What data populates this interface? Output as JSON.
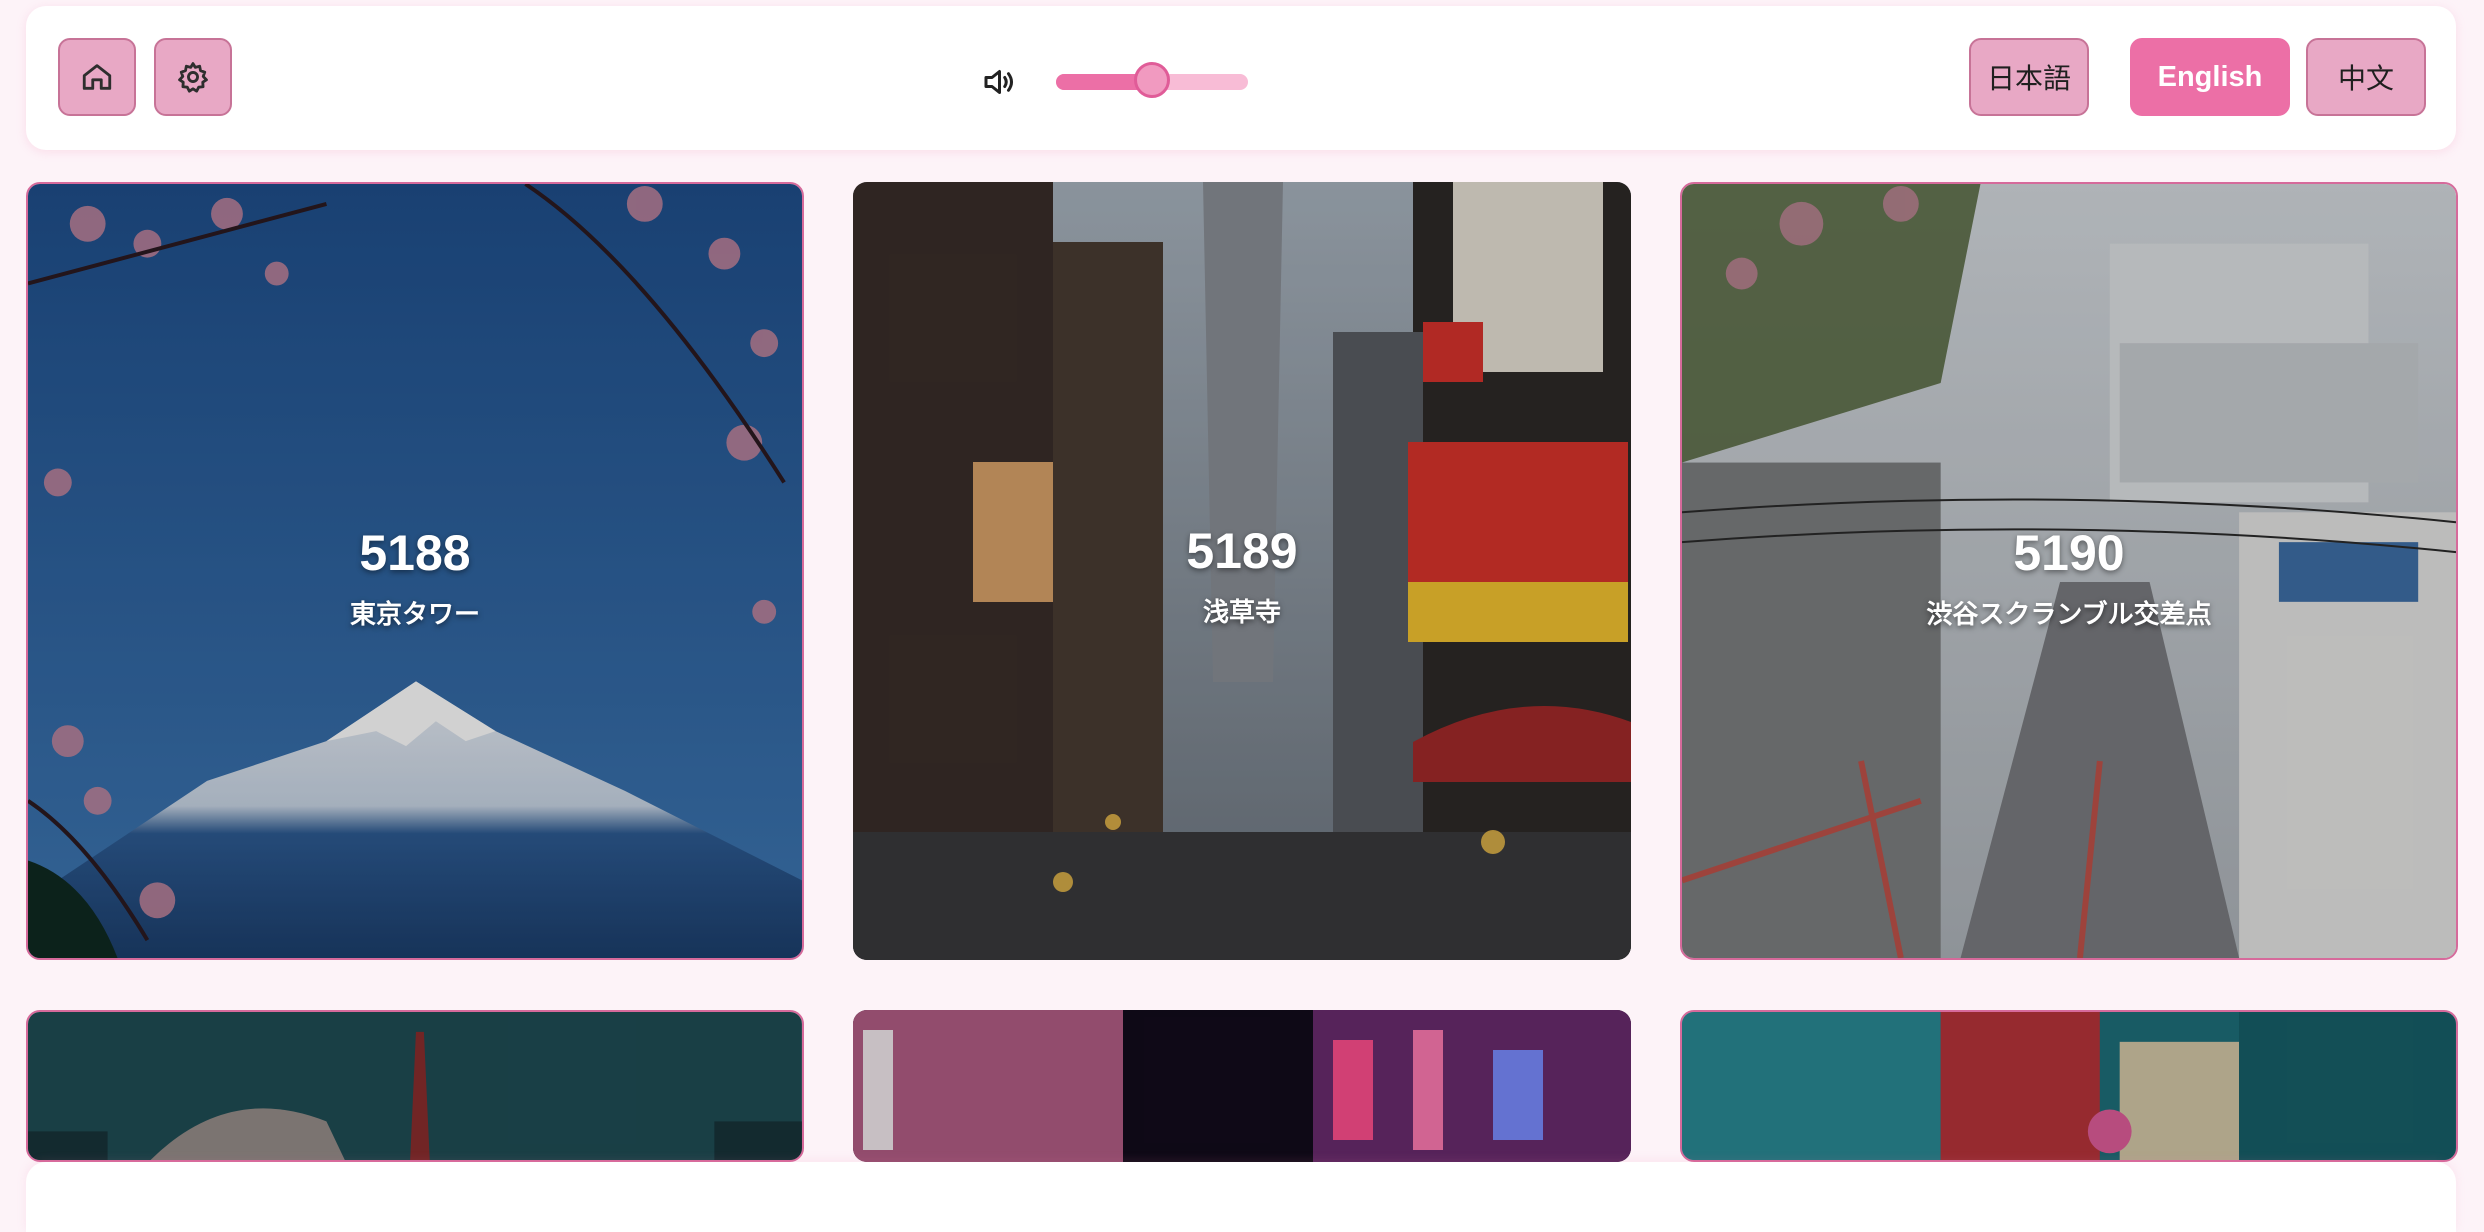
{
  "toolbar": {
    "home_icon": "home-icon",
    "settings_icon": "gear-icon",
    "volume_icon": "volume-icon",
    "volume_level": 0.5,
    "languages": [
      {
        "label": "日本語",
        "active": false
      },
      {
        "label": "English",
        "active": true
      },
      {
        "label": "中文",
        "active": false
      }
    ]
  },
  "colors": {
    "accent": "#ec6fa6",
    "button_bg": "#e8a8c5",
    "page_bg": "#fdf3f8"
  },
  "cards": [
    {
      "number": "5188",
      "name": "東京タワー",
      "scene": "mount-fuji-cherry-blossoms"
    },
    {
      "number": "5189",
      "name": "浅草寺",
      "scene": "osaka-tsutenkaku-street"
    },
    {
      "number": "5190",
      "name": "渋谷スクランブル交差点",
      "scene": "tokyo-residential-street"
    },
    {
      "number": "",
      "name": "",
      "scene": "tokyo-tower-teal-sky"
    },
    {
      "number": "",
      "name": "",
      "scene": "neon-alley-night"
    },
    {
      "number": "",
      "name": "",
      "scene": "teal-signs-buildings"
    }
  ]
}
